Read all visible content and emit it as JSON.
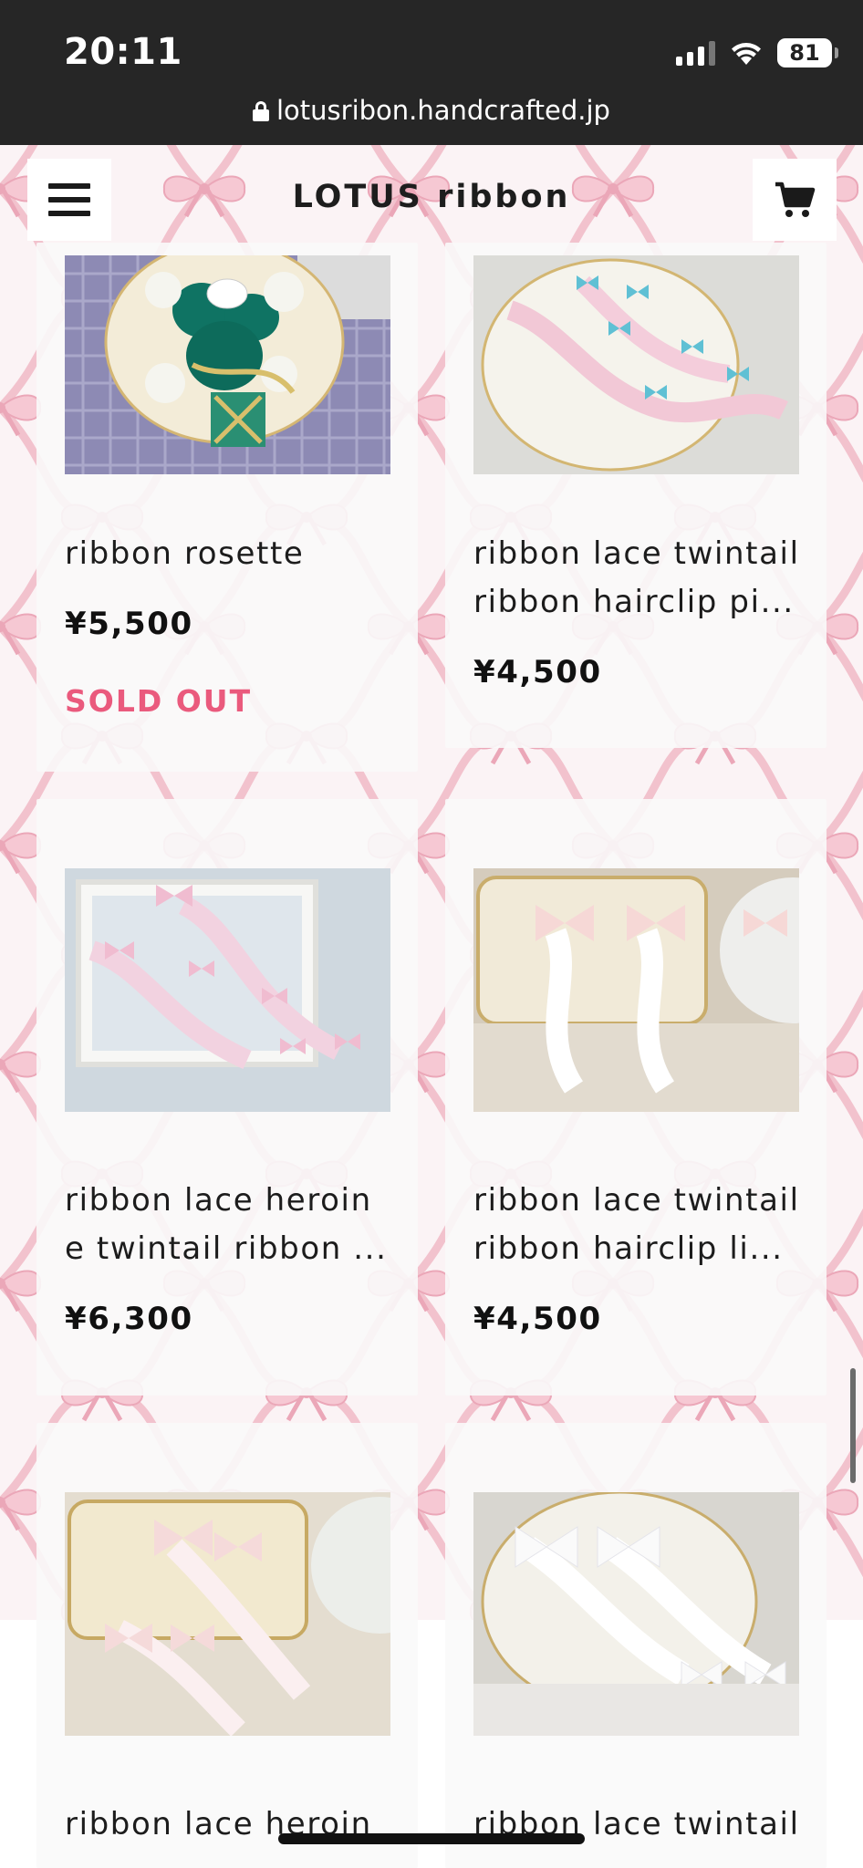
{
  "status_bar": {
    "time": "20:11",
    "battery": "81",
    "icons": [
      "signal-icon",
      "wifi-icon",
      "battery-icon"
    ]
  },
  "browser": {
    "url": "lotusribon.handcrafted.jp",
    "lock_icon": "lock-icon"
  },
  "header": {
    "title": "LOTUS ribbon",
    "menu_icon": "hamburger-menu-icon",
    "cart_icon": "cart-icon"
  },
  "colors": {
    "status_bar_bg": "#262626",
    "sold_out": "#ea5a7d",
    "ribbon_pattern": "#f2b9c6",
    "card_bg": "#fafafa"
  },
  "products": [
    {
      "name": "ribbon rosette",
      "price": "¥5,500",
      "status": "SOLD OUT"
    },
    {
      "name_lines": [
        "ribbon lace twintail",
        "ribbon hairclip pi..."
      ],
      "price": "¥4,500"
    },
    {
      "name_lines": [
        "ribbon lace heroin",
        "e twintail ribbon ..."
      ],
      "price": "¥6,300"
    },
    {
      "name_lines": [
        "ribbon lace twintail",
        "ribbon hairclip li..."
      ],
      "price": "¥4,500"
    },
    {
      "name_lines": [
        "ribbon lace heroin"
      ]
    },
    {
      "name_lines": [
        "ribbon lace twintail"
      ]
    }
  ]
}
